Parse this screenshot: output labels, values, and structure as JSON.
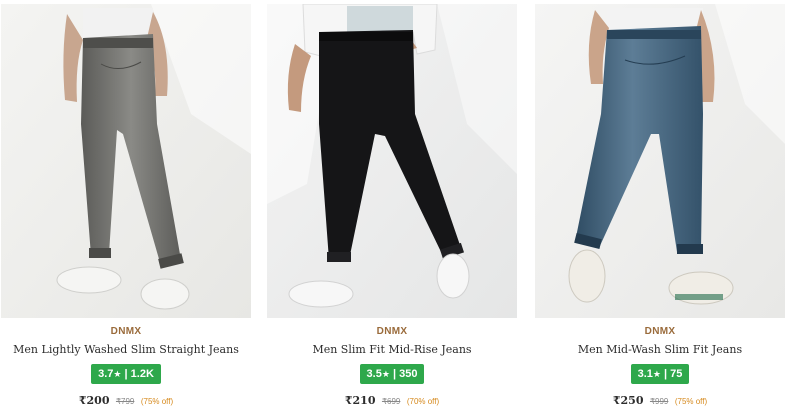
{
  "products": [
    {
      "brand": "DNMX",
      "title": "Men Lightly Washed Slim Straight Jeans",
      "rating": "3.7",
      "reviews": "1.2K",
      "price": "₹200",
      "mrp": "₹799",
      "discount": "(75% off)",
      "jean_color": "#6e6e6b",
      "image": "grey-jeans-photo"
    },
    {
      "brand": "DNMX",
      "title": "Men Slim Fit Mid-Rise Jeans",
      "rating": "3.5",
      "reviews": "350",
      "price": "₹210",
      "mrp": "₹699",
      "discount": "(70% off)",
      "jean_color": "#141416",
      "image": "black-jeans-photo"
    },
    {
      "brand": "DNMX",
      "title": "Men Mid-Wash Slim Fit Jeans",
      "rating": "3.1",
      "reviews": "75",
      "price": "₹250",
      "mrp": "₹999",
      "discount": "(75% off)",
      "jean_color": "#3f607a",
      "image": "blue-jeans-photo"
    }
  ],
  "colors": {
    "rating_badge": "#2ea84b",
    "brand": "#9a6b3b",
    "discount": "#d68a1e"
  }
}
